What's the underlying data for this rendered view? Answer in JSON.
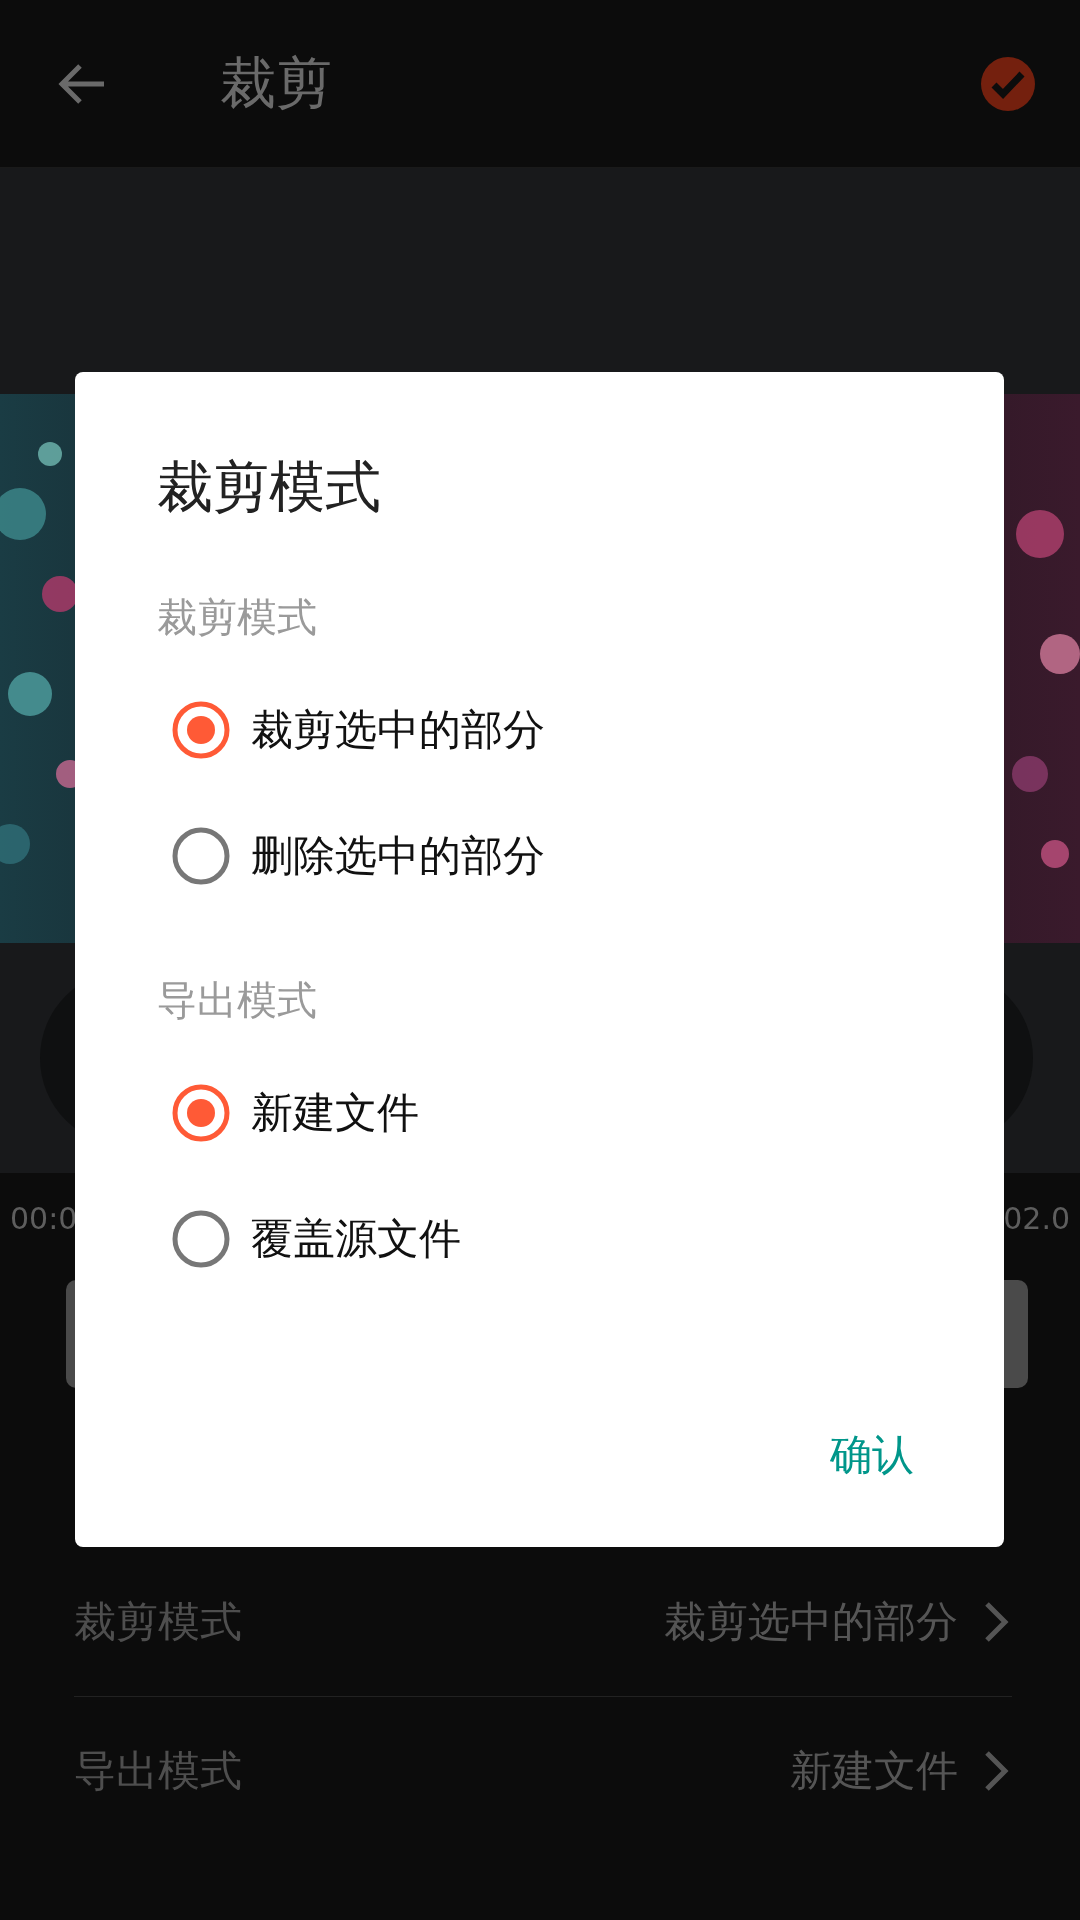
{
  "app_bar": {
    "title": "裁剪"
  },
  "timeline": {
    "start_time": "00:0",
    "end_time": "02.0"
  },
  "settings": [
    {
      "label": "裁剪模式",
      "value": "裁剪选中的部分"
    },
    {
      "label": "导出模式",
      "value": "新建文件"
    }
  ],
  "dialog": {
    "title": "裁剪模式",
    "groups": [
      {
        "label": "裁剪模式",
        "options": [
          {
            "label": "裁剪选中的部分",
            "selected": true
          },
          {
            "label": "删除选中的部分",
            "selected": false
          }
        ]
      },
      {
        "label": "导出模式",
        "options": [
          {
            "label": "新建文件",
            "selected": true
          },
          {
            "label": "覆盖源文件",
            "selected": false
          }
        ]
      }
    ],
    "confirm": "确认"
  }
}
